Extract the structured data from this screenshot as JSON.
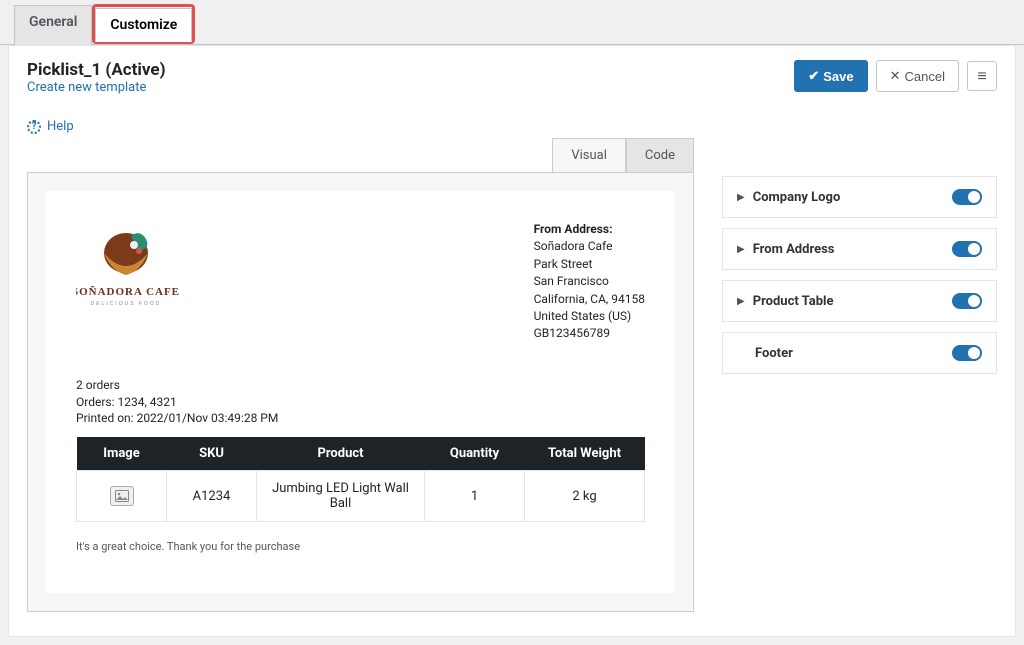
{
  "tabs": {
    "general": "General",
    "customize": "Customize"
  },
  "page": {
    "title": "Picklist_1 (Active)",
    "create_link": "Create new template"
  },
  "buttons": {
    "save": "Save",
    "cancel": "Cancel"
  },
  "help": {
    "label": "Help"
  },
  "subtabs": {
    "visual": "Visual",
    "code": "Code"
  },
  "doc": {
    "from_title": "From Address:",
    "from_lines": {
      "l1": "Soñadora Cafe",
      "l2": "Park Street",
      "l3": "San Francisco",
      "l4": "California, CA, 94158",
      "l5": "United States (US)",
      "l6": "GB123456789"
    },
    "meta": {
      "orders_count": "2 orders",
      "orders_ids": "Orders: 1234, 4321",
      "printed": "Printed on: 2022/01/Nov 03:49:28 PM"
    },
    "table": {
      "headers": {
        "image": "Image",
        "sku": "SKU",
        "product": "Product",
        "quantity": "Quantity",
        "weight": "Total Weight"
      },
      "rows": [
        {
          "sku": "A1234",
          "product": "Jumbing LED Light Wall Ball",
          "quantity": "1",
          "weight": "2 kg"
        }
      ]
    },
    "footer": "It's a great choice. Thank you for the purchase",
    "logo": {
      "brand": "SOÑADORA CAFE",
      "tagline": "DELICIOUS FOOD"
    }
  },
  "panels": {
    "company_logo": "Company Logo",
    "from_address": "From Address",
    "product_table": "Product Table",
    "footer": "Footer"
  }
}
